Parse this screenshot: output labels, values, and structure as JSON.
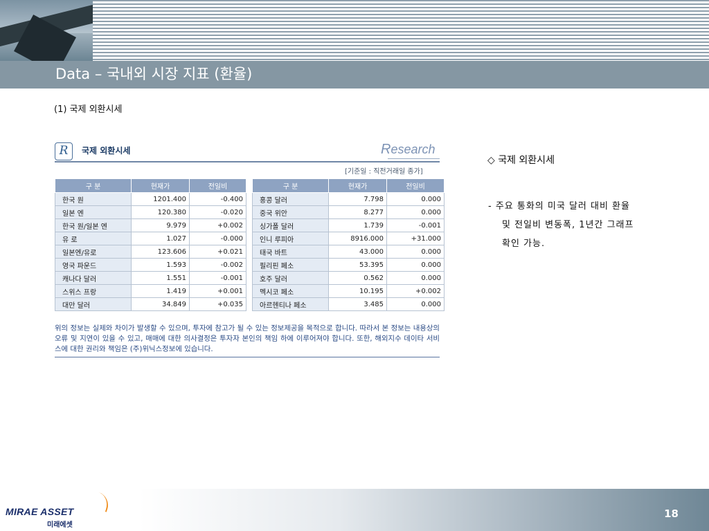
{
  "header": {
    "title": "Data – 국내외 시장 지표 (환율)"
  },
  "subheading": "(1) 국제 외환시세",
  "panel": {
    "logo_letter": "R",
    "title": "국제 외환시세",
    "brand_first": "R",
    "brand_rest": "esearch",
    "basis": "[기준일 : 직전거래일 종가]",
    "columns": [
      "구 분",
      "현재가",
      "전일비",
      "구 분",
      "현재가",
      "전일비"
    ],
    "rows": [
      {
        "left": {
          "name": "한국 원",
          "price": "1201.400",
          "change": "-0.400",
          "dir": "neg"
        },
        "right": {
          "name": "홍콩 달러",
          "price": "7.798",
          "change": "0.000",
          "dir": "zero"
        }
      },
      {
        "left": {
          "name": "일본 엔",
          "price": "120.380",
          "change": "-0.020",
          "dir": "neg"
        },
        "right": {
          "name": "중국 위안",
          "price": "8.277",
          "change": "0.000",
          "dir": "zero"
        }
      },
      {
        "left": {
          "name": "한국 원/일본 엔",
          "price": "9.979",
          "change": "+0.002",
          "dir": "pos"
        },
        "right": {
          "name": "싱가폴 달러",
          "price": "1.739",
          "change": "-0.001",
          "dir": "neg"
        }
      },
      {
        "left": {
          "name": "유 로",
          "price": "1.027",
          "change": "-0.000",
          "dir": "neg"
        },
        "right": {
          "name": "인니 루피아",
          "price": "8916.000",
          "change": "+31.000",
          "dir": "pos"
        }
      },
      {
        "left": {
          "name": "일본엔/유로",
          "price": "123.606",
          "change": "+0.021",
          "dir": "pos"
        },
        "right": {
          "name": "태국 바트",
          "price": "43.000",
          "change": "0.000",
          "dir": "zero"
        }
      },
      {
        "left": {
          "name": "영국 파운드",
          "price": "1.593",
          "change": "-0.002",
          "dir": "neg"
        },
        "right": {
          "name": "필리핀 페소",
          "price": "53.395",
          "change": "0.000",
          "dir": "zero"
        }
      },
      {
        "left": {
          "name": "캐나다 달러",
          "price": "1.551",
          "change": "-0.001",
          "dir": "neg"
        },
        "right": {
          "name": "호주 달러",
          "price": "0.562",
          "change": "0.000",
          "dir": "zero"
        }
      },
      {
        "left": {
          "name": "스위스 프랑",
          "price": "1.419",
          "change": "+0.001",
          "dir": "pos"
        },
        "right": {
          "name": "멕시코 페소",
          "price": "10.195",
          "change": "+0.002",
          "dir": "pos"
        }
      },
      {
        "left": {
          "name": "대만 달러",
          "price": "34.849",
          "change": "+0.035",
          "dir": "pos"
        },
        "right": {
          "name": "아르헨티나 페소",
          "price": "3.485",
          "change": "0.000",
          "dir": "zero"
        }
      }
    ],
    "disclaimer": "위의 정보는 실제와 차이가 발생할 수 있으며, 투자에 참고가 될 수 있는 정보제공을 목적으로 합니다. 따라서 본 정보는 내용상의 오류 및 지연이 있을 수 있고, 매매에 대한 의사결정은 투자자 본인의 책임 하에 이루어져야 합니다. 또한, 해외지수 데이타 서비스에 대한 권리와 책임은 (주)위닉스정보에 있습니다."
  },
  "notes": {
    "title": "◇ 국제 외환시세",
    "line1": "- 주요 통화의 미국 달러 대비 환율",
    "line2": "및 전일비 변동폭, 1년간 그래프",
    "line3": "확인 가능."
  },
  "footer": {
    "logo_main": "MIRAE ASSET",
    "logo_sub": "미래에셋",
    "page_number": "18"
  },
  "colors": {
    "title_bar": "#8597a3",
    "table_header": "#8ea3c2",
    "negative": "#1a2fd0",
    "positive": "#e0142a",
    "logo": "#1b2f6b"
  }
}
